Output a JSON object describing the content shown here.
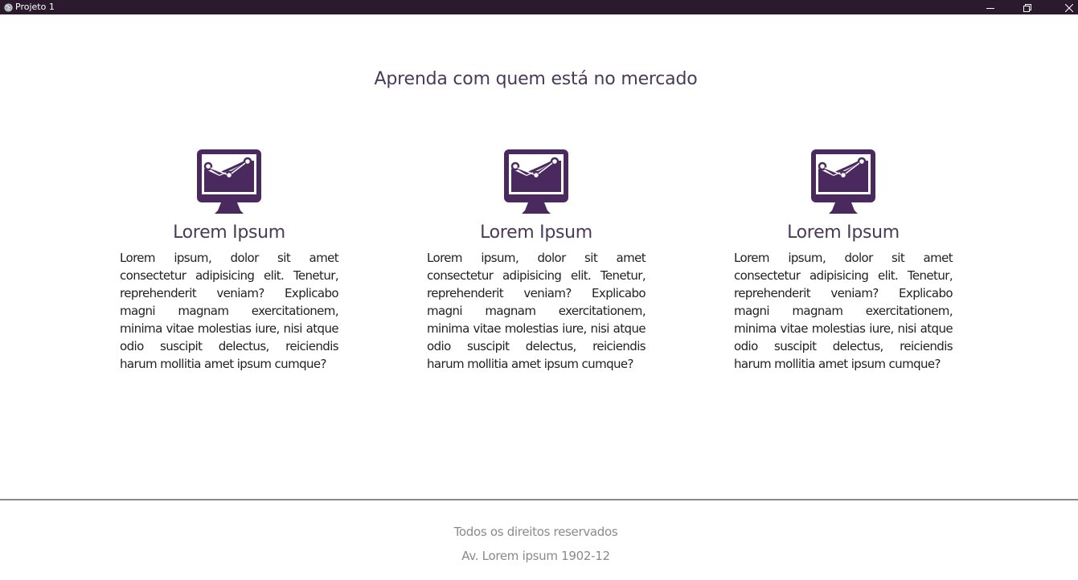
{
  "window": {
    "title": "Projeto 1",
    "icon": "globe-icon",
    "controls": [
      "minimize-icon",
      "restore-icon",
      "close-icon"
    ]
  },
  "colors": {
    "titlebar": "#2b1a2e",
    "accent": "#4a2a5e",
    "heading": "#4a3a5a",
    "footer_text": "#8a8a8a"
  },
  "main": {
    "headline": "Aprenda com quem está no mercado",
    "cards": [
      {
        "icon": "monitor-chart-icon",
        "title": "Lorem Ipsum",
        "text": "Lorem ipsum, dolor sit amet consectetur adipisicing elit. Tenetur, reprehenderit veniam? Explicabo magni magnam exercitationem, minima vitae molestias iure, nisi atque odio suscipit delectus, reiciendis harum mollitia amet ipsum cumque?"
      },
      {
        "icon": "monitor-chart-icon",
        "title": "Lorem Ipsum",
        "text": "Lorem ipsum, dolor sit amet consectetur adipisicing elit. Tenetur, reprehenderit veniam? Explicabo magni magnam exercitationem, minima vitae molestias iure, nisi atque odio suscipit delectus, reiciendis harum mollitia amet ipsum cumque?"
      },
      {
        "icon": "monitor-chart-icon",
        "title": "Lorem Ipsum",
        "text": "Lorem ipsum, dolor sit amet consectetur adipisicing elit. Tenetur, reprehenderit veniam? Explicabo magni magnam exercitationem, minima vitae molestias iure, nisi atque odio suscipit delectus, reiciendis harum mollitia amet ipsum cumque?"
      }
    ]
  },
  "footer": {
    "rights": "Todos os direitos reservados",
    "address": "Av. Lorem ipsum 1902-12"
  }
}
